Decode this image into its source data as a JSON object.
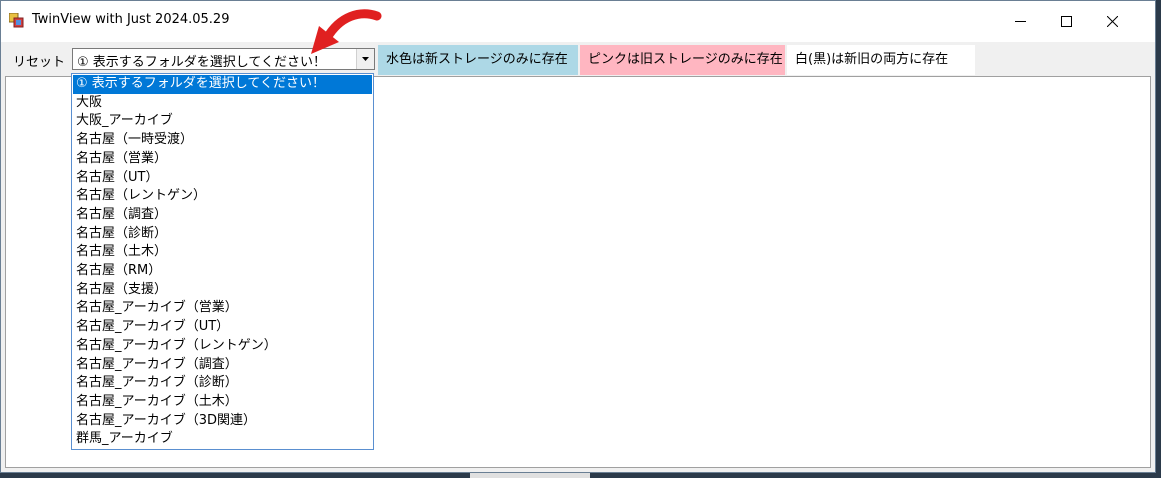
{
  "window": {
    "title": "TwinView with Just  2024.05.29"
  },
  "toolbar": {
    "reset_label": "リセット",
    "folder_combo_value": "① 表示するフォルダを選択してください！",
    "legend_cyan": "水色は新ストレージのみに存在",
    "legend_pink": "ピンクは旧ストレージのみに存在",
    "legend_white": "白(黒)は新旧の両方に存在"
  },
  "colors": {
    "accent_selected": "#0078d7",
    "legend_cyan": "#add8e6",
    "legend_pink": "#ffb6c1",
    "annotation_arrow": "#e02020"
  },
  "dropdown": {
    "items": [
      "① 表示するフォルダを選択してください！",
      "大阪",
      "大阪_アーカイブ",
      "名古屋（一時受渡）",
      "名古屋（営業）",
      "名古屋（UT）",
      "名古屋（レントゲン）",
      "名古屋（調査）",
      "名古屋（診断）",
      "名古屋（土木）",
      "名古屋（RM）",
      "名古屋（支援）",
      "名古屋_アーカイブ（営業）",
      "名古屋_アーカイブ（UT）",
      "名古屋_アーカイブ（レントゲン）",
      "名古屋_アーカイブ（調査）",
      "名古屋_アーカイブ（診断）",
      "名古屋_アーカイブ（土木）",
      "名古屋_アーカイブ（3D関連）",
      "群馬_アーカイブ"
    ],
    "selected_index": 0
  },
  "icons": {
    "app": "app-window-icon",
    "minimize": "minimize-icon",
    "maximize": "maximize-icon",
    "close": "close-icon",
    "dropdown": "chevron-down-icon",
    "annotation": "red-arrow-icon"
  }
}
